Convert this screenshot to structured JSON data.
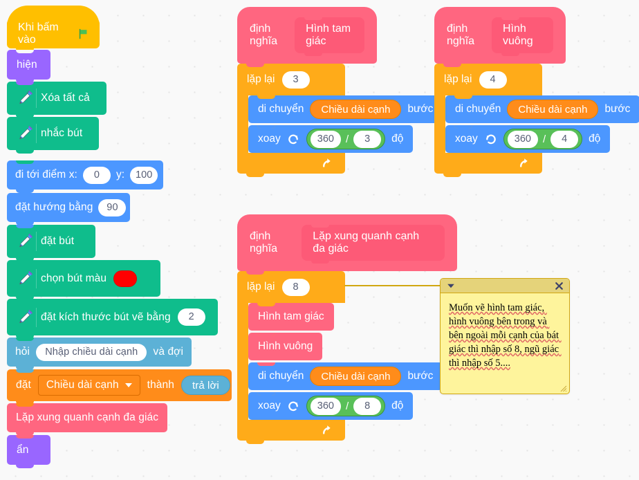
{
  "app": {
    "title": "Scratch code canvas"
  },
  "colors": {
    "event": "#ffbf00",
    "looks": "#9966ff",
    "pen": "#0fbd8c",
    "motion": "#4c97ff",
    "sensing": "#5cb1d6",
    "variables": "#ff8c1a",
    "custom": "#ff6680",
    "control": "#ffab19",
    "operators": "#59c059",
    "pen_color_swatch": "#ff0000",
    "canvas_background": "#f9f9f9"
  },
  "main_script": {
    "hat": {
      "label": "Khi bấm vào",
      "icon": "green-flag-icon"
    },
    "blocks": [
      {
        "label": "hiện"
      },
      {
        "label": "Xóa tất cả",
        "icon": "pen-icon"
      },
      {
        "label": "nhắc bút",
        "icon": "pen-icon"
      },
      {
        "label_x": "đi tới điểm x:",
        "x": "0",
        "label_y": "y:",
        "y": "100"
      },
      {
        "label": "đặt hướng bằng",
        "value": "90"
      },
      {
        "label": "đặt bút",
        "icon": "pen-icon"
      },
      {
        "label": "chọn bút màu",
        "icon": "pen-icon",
        "swatch": "#ff0000"
      },
      {
        "label": "đặt kích thước bút vẽ bằng",
        "icon": "pen-icon",
        "value": "2"
      },
      {
        "label_pre": "hỏi",
        "prompt": "Nhập chiều dài cạnh",
        "label_post": "và đợi"
      },
      {
        "label_pre": "đặt",
        "variable": "Chiều dài cạnh",
        "label_mid": "thành",
        "reporter": "trả lời"
      },
      {
        "label": "Lặp xung quanh cạnh đa giác"
      },
      {
        "label": "ẩn"
      }
    ]
  },
  "def_triangle": {
    "define_label": "định nghĩa",
    "name": "Hình tam giác",
    "repeat_label": "lặp lại",
    "repeat_count": "3",
    "move_label": "di chuyển",
    "move_var": "Chiều dài cạnh",
    "move_suffix": "bước",
    "turn_label": "xoay",
    "turn_direction": "clockwise",
    "turn_numerator": "360",
    "turn_slash": "/",
    "turn_denominator": "3",
    "turn_suffix": "độ"
  },
  "def_square": {
    "define_label": "định nghĩa",
    "name": "Hình vuông",
    "repeat_label": "lặp lại",
    "repeat_count": "4",
    "move_label": "di chuyển",
    "move_var": "Chiều dài cạnh",
    "move_suffix": "bước",
    "turn_label": "xoay",
    "turn_direction": "counterclockwise",
    "turn_numerator": "360",
    "turn_slash": "/",
    "turn_denominator": "4",
    "turn_suffix": "độ"
  },
  "def_polygon": {
    "define_label": "định nghĩa",
    "name": "Lặp xung quanh cạnh đa giác",
    "repeat_label": "lặp lại",
    "repeat_count": "8",
    "call_triangle": "Hình tam giác",
    "call_square": "Hình vuông",
    "move_label": "di chuyển",
    "move_var": "Chiều dài cạnh",
    "move_suffix": "bước",
    "turn_label": "xoay",
    "turn_direction": "clockwise",
    "turn_numerator": "360",
    "turn_slash": "/",
    "turn_denominator": "8",
    "turn_suffix": "độ"
  },
  "comment": {
    "text": "Muốn vẽ hình tam giác, hình vuông bên trong và bên ngoài mỗi cạnh của bát giác thì nhập số 8, ngũ giác thì nhập số 5....",
    "collapse_icon": "chevron-down-icon",
    "close_icon": "close-icon"
  }
}
